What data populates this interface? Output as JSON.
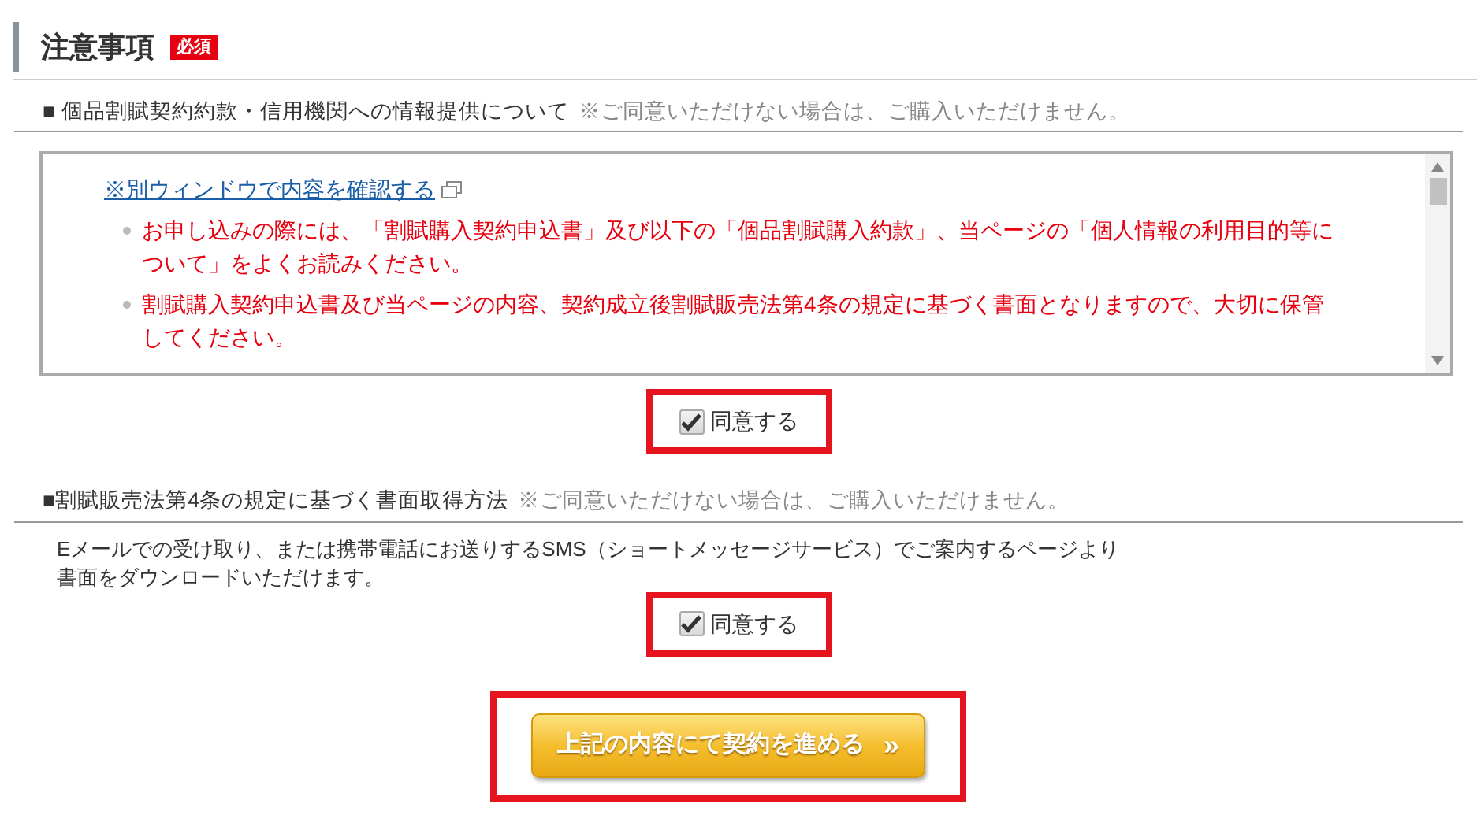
{
  "heading": {
    "title": "注意事項",
    "badge": "必須"
  },
  "sections": [
    {
      "title": "■ 個品割賦契約約款・信用機関への情報提供について",
      "note": "※ご同意いただけない場合は、ご購入いただけません。",
      "kind": "scrollbox",
      "link": "※別ウィンドウで内容を確認する",
      "bullets": [
        "お申し込みの際には、「割賦購入契約申込書」及び以下の「個品割賦購入約款」、当ページの「個人情報の利用目的等について」をよくお読みください。",
        "割賦購入契約申込書及び当ページの内容、契約成立後割賦販売法第4条の規定に基づく書面となりますので、大切に保管してください。"
      ],
      "agree": {
        "label": "同意する",
        "checked": true
      }
    },
    {
      "title": "■割賦販売法第4条の規定に基づく書面取得方法",
      "note": "※ご同意いただけない場合は、ご購入いただけません。",
      "kind": "text",
      "lines": [
        "Eメールでの受け取り、または携帯電話にお送りするSMS（ショートメッセージサービス）でご案内するページより",
        "書面をダウンロードいただけます。"
      ],
      "agree": {
        "label": "同意する",
        "checked": true
      }
    }
  ],
  "submit": {
    "label": "上記の内容にて契約を進める",
    "arrow": "»"
  }
}
